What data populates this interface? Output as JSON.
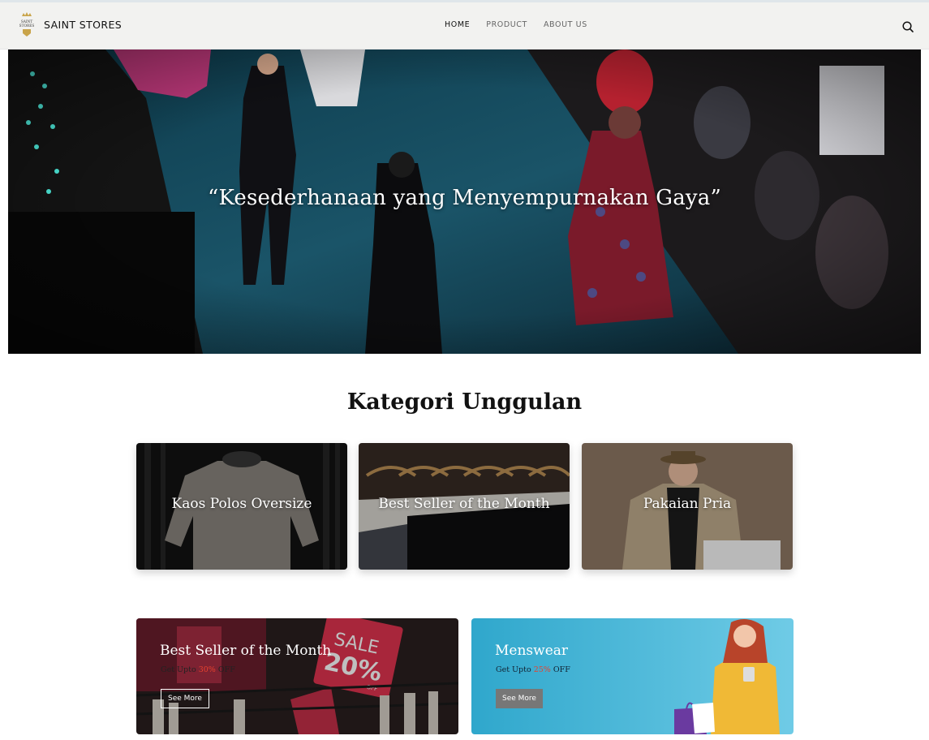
{
  "brand": {
    "name": "SAINT STORES",
    "logo_text": "SAINT STORES",
    "icon": "crown-logo"
  },
  "nav": {
    "items": [
      "HOME",
      "PRODUCT",
      "ABOUT US"
    ],
    "active": "HOME"
  },
  "header": {
    "search_icon": "search-icon"
  },
  "hero": {
    "quote": "“Kesederhanaan yang Menyempurnakan Gaya”"
  },
  "categories": {
    "title": "Kategori Unggulan",
    "items": [
      {
        "label": "Kaos Polos Oversize"
      },
      {
        "label": "Best Seller of the Month"
      },
      {
        "label": "Pakaian Pria"
      }
    ]
  },
  "promos": [
    {
      "title": "Best Seller of the Month",
      "sub_prefix": "Get Upto",
      "percent": "30%",
      "sub_suffix": "OFF",
      "button": "See More",
      "sale_word": "SALE",
      "sale_pct": "20%",
      "sale_off": "OFF"
    },
    {
      "title": "Menswear",
      "sub_prefix": "Get Upto",
      "percent": "25%",
      "sub_suffix": "OFF",
      "button": "See More"
    }
  ],
  "colors": {
    "accent_percent": "#e8412e",
    "header_bg": "#f2f2f0",
    "promo_right_bg": "#3fb3d6"
  }
}
